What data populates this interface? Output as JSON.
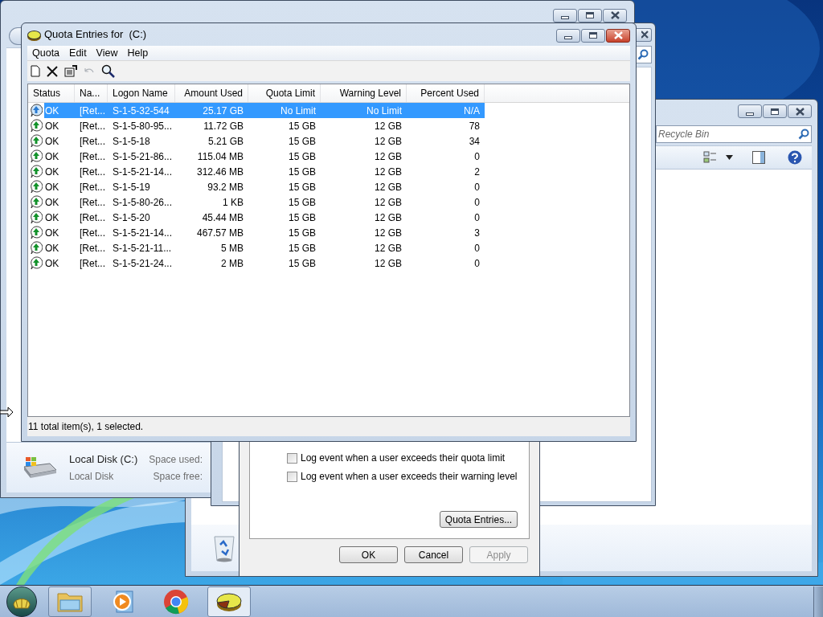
{
  "quota_window": {
    "title": "Quota Entries for  (C:)",
    "menu": [
      "Quota",
      "Edit",
      "View",
      "Help"
    ],
    "toolbar": [
      {
        "kind": "new",
        "disabled": false
      },
      {
        "kind": "delete",
        "disabled": false
      },
      {
        "kind": "properties",
        "disabled": false
      },
      {
        "kind": "undo",
        "disabled": true
      },
      {
        "kind": "find",
        "disabled": false
      }
    ],
    "columns": [
      "Status",
      "Na...",
      "Logon Name",
      "Amount Used",
      "Quota Limit",
      "Warning Level",
      "Percent Used"
    ],
    "rows": [
      {
        "cells": [
          "OK",
          "[Ret...",
          "S-1-5-32-544",
          "25.17 GB",
          "No Limit",
          "No Limit",
          "N/A"
        ],
        "selected": true
      },
      {
        "cells": [
          "OK",
          "[Ret...",
          "S-1-5-80-95...",
          "11.72 GB",
          "15 GB",
          "12 GB",
          "78"
        ],
        "selected": false
      },
      {
        "cells": [
          "OK",
          "[Ret...",
          "S-1-5-18",
          "5.21 GB",
          "15 GB",
          "12 GB",
          "34"
        ],
        "selected": false
      },
      {
        "cells": [
          "OK",
          "[Ret...",
          "S-1-5-21-86...",
          "115.04 MB",
          "15 GB",
          "12 GB",
          "0"
        ],
        "selected": false
      },
      {
        "cells": [
          "OK",
          "[Ret...",
          "S-1-5-21-14...",
          "312.46 MB",
          "15 GB",
          "12 GB",
          "2"
        ],
        "selected": false
      },
      {
        "cells": [
          "OK",
          "[Ret...",
          "S-1-5-19",
          "93.2 MB",
          "15 GB",
          "12 GB",
          "0"
        ],
        "selected": false
      },
      {
        "cells": [
          "OK",
          "[Ret...",
          "S-1-5-80-26...",
          "1 KB",
          "15 GB",
          "12 GB",
          "0"
        ],
        "selected": false
      },
      {
        "cells": [
          "OK",
          "[Ret...",
          "S-1-5-20",
          "45.44 MB",
          "15 GB",
          "12 GB",
          "0"
        ],
        "selected": false
      },
      {
        "cells": [
          "OK",
          "[Ret...",
          "S-1-5-21-14...",
          "467.57 MB",
          "15 GB",
          "12 GB",
          "3"
        ],
        "selected": false
      },
      {
        "cells": [
          "OK",
          "[Ret...",
          "S-1-5-21-11...",
          "5 MB",
          "15 GB",
          "12 GB",
          "0"
        ],
        "selected": false
      },
      {
        "cells": [
          "OK",
          "[Ret...",
          "S-1-5-21-24...",
          "2 MB",
          "15 GB",
          "12 GB",
          "0"
        ],
        "selected": false
      }
    ],
    "status_bar": "11 total item(s), 1 selected."
  },
  "explorer_details": {
    "name": "Local Disk (C:)",
    "type": "Local Disk",
    "labels": [
      "Space used:",
      "Space free:"
    ]
  },
  "recycle_window": {
    "search_placeholder": "Recycle Bin"
  },
  "properties_dialog": {
    "options": [
      {
        "label": "Log event when a user exceeds their quota limit",
        "checked": false
      },
      {
        "label": "Log event when a user exceeds their warning level",
        "checked": false
      }
    ],
    "quota_entries_button": "Quota Entries...",
    "buttons": [
      {
        "label": "OK",
        "disabled": false
      },
      {
        "label": "Cancel",
        "disabled": false
      },
      {
        "label": "Apply",
        "disabled": true
      }
    ]
  },
  "taskbar": {
    "items": [
      {
        "kind": "explorer",
        "running": true,
        "selected": false
      },
      {
        "kind": "media",
        "running": false,
        "selected": false
      },
      {
        "kind": "browser",
        "running": false,
        "selected": false
      },
      {
        "kind": "quota",
        "running": true,
        "selected": true
      }
    ]
  }
}
